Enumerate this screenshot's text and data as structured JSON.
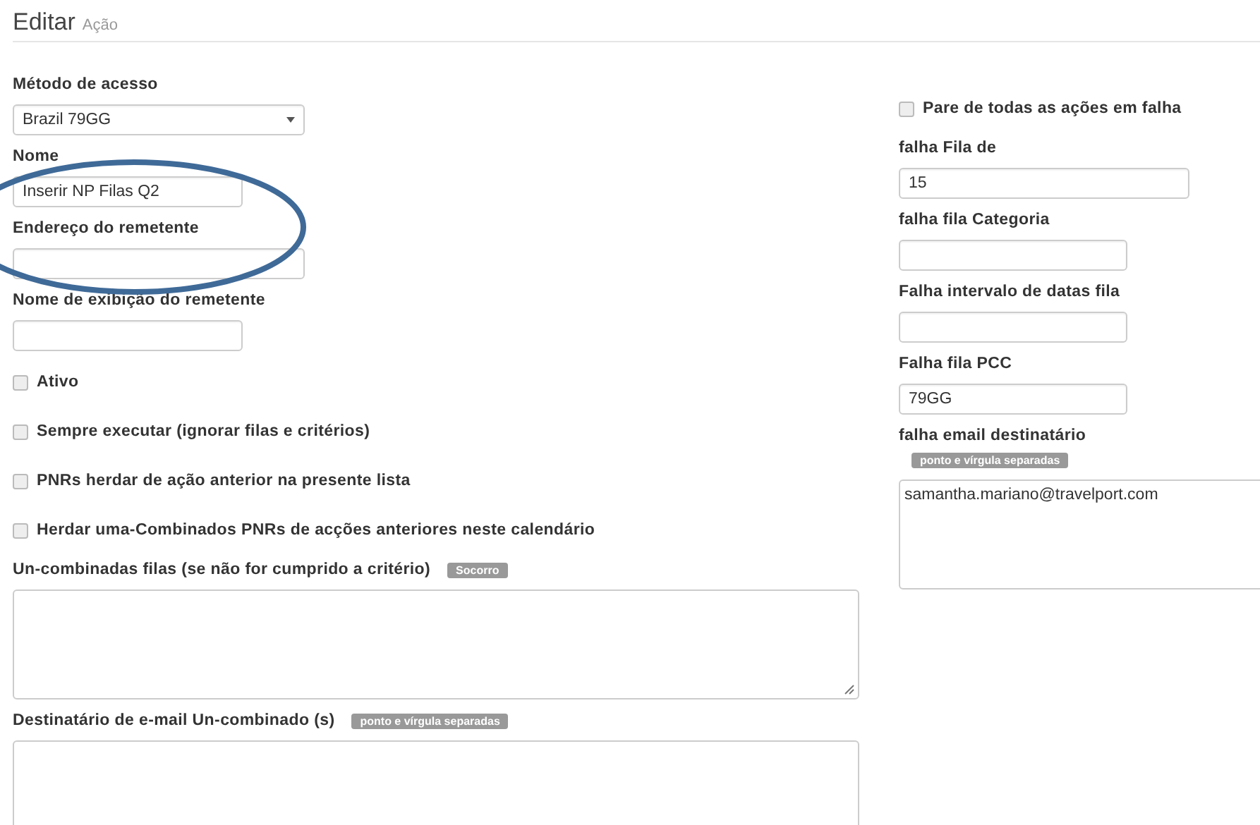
{
  "header": {
    "title": "Editar",
    "subtitle": "Ação"
  },
  "left_fields": [
    {
      "kind": "select",
      "label": "Método de acesso",
      "value": "Brazil 79GG"
    },
    {
      "kind": "input",
      "label": "Nome",
      "value": "Inserir NP Filas Q2"
    },
    {
      "kind": "input",
      "label": "Endereço do remetente"
    },
    {
      "kind": "input",
      "label": "Nome de exibição do remetente"
    },
    {
      "kind": "checkbox",
      "label": "Ativo",
      "checked": false
    },
    {
      "kind": "checkbox",
      "label": "Sempre executar (ignorar filas e critérios)",
      "checked": false
    },
    {
      "kind": "checkbox",
      "label": "PNRs herdar de ação anterior na presente lista",
      "checked": false
    },
    {
      "kind": "checkbox",
      "label": "Herdar uma-Combinados PNRs de acções anteriores neste calendário",
      "checked": false
    },
    {
      "kind": "textarea",
      "label": "Un-combinadas filas (se não for cumprido a critério)",
      "badge": "Socorro"
    },
    {
      "kind": "textarea",
      "label": "Destinatário de e-mail Un-combinado (s)",
      "badge": "ponto e vírgula separadas"
    }
  ],
  "right_fields": [
    {
      "kind": "checkbox",
      "label": "Pare de todas as ações em falha",
      "checked": false
    },
    {
      "kind": "input",
      "label": "falha Fila de",
      "value": "15"
    },
    {
      "kind": "input",
      "label": "falha fila Categoria"
    },
    {
      "kind": "input",
      "label": "Falha intervalo de datas fila"
    },
    {
      "kind": "input",
      "label": "Falha fila PCC",
      "value": "79GG"
    },
    {
      "kind": "textarea",
      "label": "falha email destinatário",
      "badge": "ponto e vírgula separadas",
      "value": "samantha.mariano@travelport.com"
    }
  ]
}
